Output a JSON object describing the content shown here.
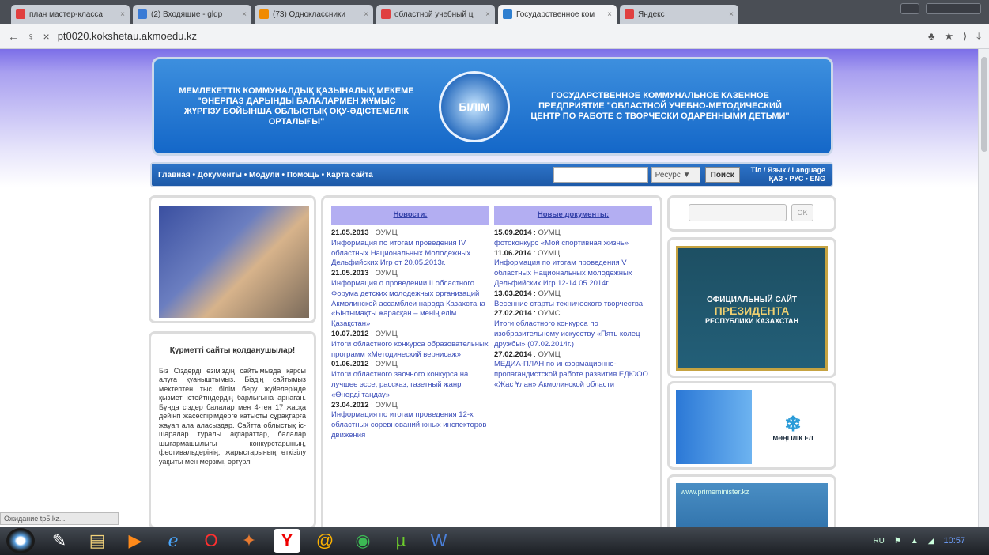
{
  "tabs": [
    {
      "label": "план мастер-класса",
      "color": "#e04040",
      "active": false
    },
    {
      "label": "(2) Входящие - gldp",
      "color": "#3a7bd5",
      "active": false
    },
    {
      "label": "(73) Одноклассники",
      "color": "#f08a00",
      "active": false
    },
    {
      "label": "областной учебный ц",
      "color": "#e04040",
      "active": false
    },
    {
      "label": "Государственное ком",
      "color": "#2f7fd0",
      "active": true
    },
    {
      "label": "Яндекс",
      "color": "#e04040",
      "active": false
    }
  ],
  "address": {
    "url": "pt0020.kokshetau.akmoedu.kz"
  },
  "banner": {
    "left_text": "МЕМЛЕКЕТТІК КОММУНАЛДЫҚ ҚАЗЫНАЛЫҚ МЕКЕМЕ \"ӨНЕРПАЗ ДАРЫНДЫ БАЛАЛАРМЕН ЖҰМЫС ЖҮРГІЗУ БОЙЫНША ОБЛЫСТЫҚ ОҚУ-ӘДІСТЕМЕЛІК ОРТАЛЫҒЫ\"",
    "emblem": "БІЛІМ",
    "right_text": "ГОСУДАРСТВЕННОЕ КОММУНАЛЬНОЕ КАЗЕННОЕ ПРЕДПРИЯТИЕ \"ОБЛАСТНОЙ УЧЕБНО-МЕТОДИЧЕСКИЙ ЦЕНТР ПО РАБОТЕ С ТВОРЧЕСКИ ОДАРЕННЫМИ ДЕТЬМИ\""
  },
  "navbar": {
    "links": "Главная • Документы • Модули • Помощь • Карта сайта",
    "select": "Ресурс",
    "search_button": "Поиск",
    "lang_line1": "Тіл / Язык / Language",
    "lang_line2": "ҚАЗ • РУС • ENG"
  },
  "about": {
    "title": "Құрметті сайты қолданушылар!",
    "text": "Біз Сіздерді өзіміздің сайтымызда қарсы алуға қуаныштымыз. Біздің сайтымыз мектептен тыс білім беру жүйелерінде қызмет істейтіндердің барлығына арнаған. Бұнда сіздер балалар мен 4-тен 17 жасқа дейінгі жасөспірімдерге қатысты сұрақтарға жауап ала аласыздар. Сайтта облыстық іс-шаралар туралы ақпараттар, балалар шығармашылығы конкурстарының, фестивальдерінің, жарыстарының өткізілу уақыты мен мерзімі, әртүрлі"
  },
  "news": {
    "col1_header": "Новости:",
    "col2_header": "Новые документы:",
    "col1": [
      {
        "date": "21.05.2013",
        "org": "ОУМЦ",
        "text": "Информация по итогам проведения IV областных Национальных Молодежных Дельфийских Игр от 20.05.2013г."
      },
      {
        "date": "21.05.2013",
        "org": "ОУМЦ",
        "text": "Информация о проведении II областного Форума детских молодежных организаций Акмолинской ассамблеи народа Казахстана «Ынтымақты жарасқан – менің елім Қазақстан»"
      },
      {
        "date": "10.07.2012",
        "org": "ОУМЦ",
        "text": "Итоги областного конкурса образовательных программ «Методический вернисаж»"
      },
      {
        "date": "01.06.2012",
        "org": "ОУМЦ",
        "text": "Итоги областного заочного конкурса на лучшее эссе, рассказ, газетный жанр «Өнерді таңдау»"
      },
      {
        "date": "23.04.2012",
        "org": "ОУМЦ",
        "text": "Информация по итогам проведения 12-х областных соревнований юных инспекторов движения"
      }
    ],
    "col2": [
      {
        "date": "15.09.2014",
        "org": "ОУМЦ",
        "text": "фотоконкурс «Мой спортивная жизнь»"
      },
      {
        "date": "11.06.2014",
        "org": "ОУМЦ",
        "text": "Информация по итогам проведения V областных Национальных молодежных Дельфийских Игр 12-14.05.2014г."
      },
      {
        "date": "13.03.2014",
        "org": "ОУМЦ",
        "text": "Весенние старты технического творчества"
      },
      {
        "date": "27.02.2014",
        "org": "ОУМС",
        "text": "Итоги областного конкурса по изобразительному искусству «Пять колец дружбы» (07.02.2014г.)"
      },
      {
        "date": "27.02.2014",
        "org": "ОУМЦ",
        "text": "МЕДИА-ПЛАН по информационно-пропагандистской работе развития ЕДЮОО «Жас Ұлан» Акмолинской области"
      }
    ]
  },
  "login": {
    "ok_label": "OK"
  },
  "side_banners": {
    "president_a": "ОФИЦИАЛЬНЫЙ САЙТ",
    "president_b": "ПРЕЗИДЕНТА",
    "president_c": "РЕСПУБЛИКИ КАЗАХСТАН",
    "mangilik": "МӘҢГІЛІК ЕЛ",
    "primeminister": "www.primeminister.kz"
  },
  "status_text": "Ожидание tp5.kz...",
  "tray": {
    "lang": "RU",
    "clock": "10:57"
  }
}
